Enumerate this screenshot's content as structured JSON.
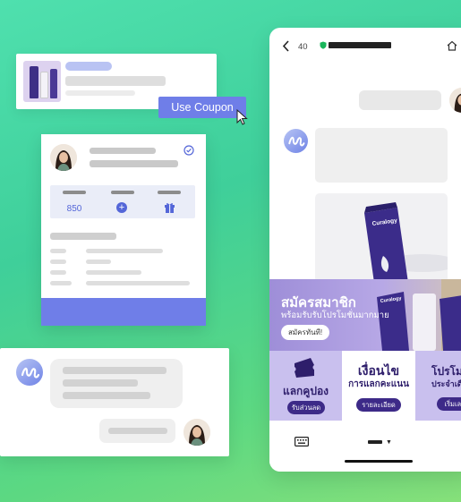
{
  "coupon_card": {
    "button_label": "Use Coupon"
  },
  "profile_card": {
    "stats": [
      {
        "value": "850"
      },
      {
        "value": "+"
      },
      {
        "value": ""
      }
    ]
  },
  "phone": {
    "status_count": "40",
    "banner": {
      "title": "สมัครสมาชิก",
      "subtitle": "พร้อมรับรับโปรโมชั่นมากมาย",
      "button_label": "สมัครทันที!"
    },
    "tiles": [
      {
        "title": "แลกคูปอง",
        "button_label": "รับส่วนลด"
      },
      {
        "title_line1": "เงื่อนไข",
        "title_line2": "การแลกคะแนน",
        "button_label": "รายละเอียด"
      },
      {
        "title_line1": "โปรโม",
        "title_line2": "ประจำเดื",
        "button_label": "เริ่มเลย"
      }
    ],
    "product_brand": "Curalogy"
  },
  "colors": {
    "accent": "#6f7ee8",
    "deep_purple": "#3d2a88",
    "background_green": "#4fe0ae"
  }
}
